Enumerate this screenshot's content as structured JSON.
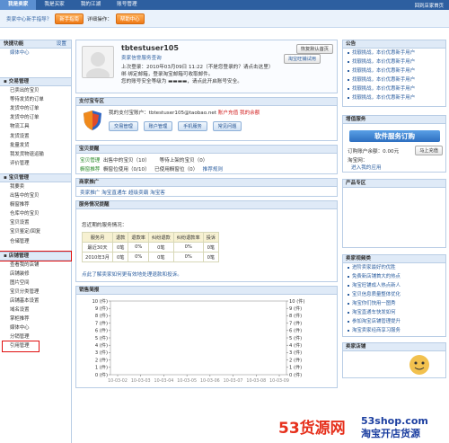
{
  "topbar": {
    "tabs": [
      "我是卖家",
      "我是买家",
      "我的江湖",
      "账号管理"
    ],
    "right": "回到店家首页"
  },
  "subbar": {
    "label": "卖家中心新手指导？",
    "btn1": "新手指南",
    "text2": "详细操作：",
    "btn2": "帮助中心"
  },
  "sidebar": {
    "quick": {
      "title": "快捷功能",
      "ext": "设置",
      "items": [
        "媒体中心"
      ]
    },
    "trade": {
      "title": "交易管理",
      "items": [
        "已卖出的宝贝",
        "等待发货的订单",
        "发货中的订单",
        "发货中的订单",
        "物流工具",
        "发货设置",
        "批量发货",
        "我发货物退运输",
        "评价管理"
      ]
    },
    "goods": {
      "title": "宝贝管理",
      "items": [
        "我要卖",
        "出售中的宝贝",
        "橱窗推荐",
        "仓库中的宝贝",
        "宝贝设置",
        "宝贝鉴定/回复",
        "仓储管理"
      ]
    },
    "shop": {
      "title": "店铺管理",
      "items": [
        "查看我的店铺",
        "店铺装修",
        "图片空间",
        "宝贝分类管理",
        "店铺基本设置",
        "域名设置",
        "掌柜推荐",
        "媒体中心",
        "分销管理",
        "引用管理"
      ]
    }
  },
  "profile": {
    "username": "tbtestuser105",
    "link1": "卖家信誉服务查询",
    "login_info": "上次登录：2010年03月09日 11:22（不是您登录的？请点击这里）",
    "email_info": "绑 绑定邮箱，登录淘宝邮箱可收取邮件。",
    "security": "您的账号安全等级为 ▬▬▬▬，请点此开启账号安全。",
    "btn_restore": "恢复默认首页",
    "btn_trial": "淘宝旺铺试用"
  },
  "alipay": {
    "title": "支付宝专区",
    "account": "我的支付宝账户：tbtestuser105@taobao.net",
    "recharge": "账户充值",
    "balance": "我的余额",
    "buttons": [
      "交易管理",
      "账户管理",
      "手机服务",
      "常见问题"
    ]
  },
  "babyinfo": {
    "title": "宝贝提醒",
    "r1": [
      "宝贝管理",
      "出售中的宝贝（10）",
      "等待上架的宝贝（0）"
    ],
    "r2": [
      "橱窗推荐",
      "橱窗位使用（0/10）",
      "已使用橱窗位（0）",
      "推荐规则"
    ]
  },
  "promo": {
    "title": "商家推广",
    "items": [
      "卖家推广",
      "淘宝直通车",
      "超级卖霸",
      "淘宝客"
    ]
  },
  "service": {
    "title": "服务情况提醒",
    "desc": "您近期的服务情况：",
    "headers": [
      "服务月",
      "退款",
      "退款率",
      "纠纷退款",
      "纠纷退款率",
      "投诉"
    ],
    "rows": [
      [
        "最近30天",
        "0笔",
        "0%",
        "0笔",
        "0%",
        "0笔"
      ],
      [
        "2010年3月",
        "0笔",
        "0%",
        "0笔",
        "0%",
        "0笔"
      ]
    ],
    "foot": "点此了解卖家如何更有效地处理退款和投诉。"
  },
  "sales": {
    "title": "销售简报",
    "y_left": [
      "10 (件)",
      "9 (件)",
      "8 (件)",
      "7 (件)",
      "6 (件)",
      "5 (件)",
      "4 (件)",
      "3 (件)",
      "2 (件)",
      "1 (件)",
      "0 (件)"
    ],
    "y_right": [
      "10 (件)",
      "9 (件)",
      "8 (件)",
      "7 (件)",
      "6 (件)",
      "5 (件)",
      "4 (件)",
      "3 (件)",
      "2 (件)",
      "1 (件)",
      "0 (件)"
    ],
    "x": [
      "10-03-02",
      "10-03-03",
      "10-03-04",
      "10-03-05",
      "10-03-06",
      "10-03-07",
      "10-03-08",
      "10-03-09"
    ]
  },
  "right": {
    "notice_title": "公告",
    "notices": [
      "找靓挑战，本价优惠新手用户",
      "找靓挑战，本价优惠新手用户",
      "找靓挑战，本价优惠新手用户",
      "找靓挑战，本价优惠新手用户",
      "找靓挑战，本价优惠新手用户",
      "找靓挑战，本价优惠新手用户"
    ],
    "svc_title": "增值服务",
    "order_btn": "软件服务订购",
    "balance_label": "订购账户余额：0.00元",
    "recharge_btn": "马上充值",
    "shop_label": "淘宝网：",
    "shop_link": "进入我的应用",
    "product_title": "产品专区",
    "seller_title": "卖家视频类",
    "seller_items": [
      "进阶卖家最好的优胜",
      "免费新店铺首大的热点",
      "淘宝旺铺成人热点新人",
      "宝贝信息质量整体优化",
      "淘宝你们快用一图秀",
      "淘宝直通车快发如何",
      "参加淘宝店铺管理提升",
      "淘宝卖家经商享习服务"
    ],
    "bottom_title": "卖家店铺"
  },
  "watermark": {
    "brand_num": "53",
    "brand_text": "货源网",
    "url": "53shop.com",
    "slogan": "淘宝开店货源"
  }
}
